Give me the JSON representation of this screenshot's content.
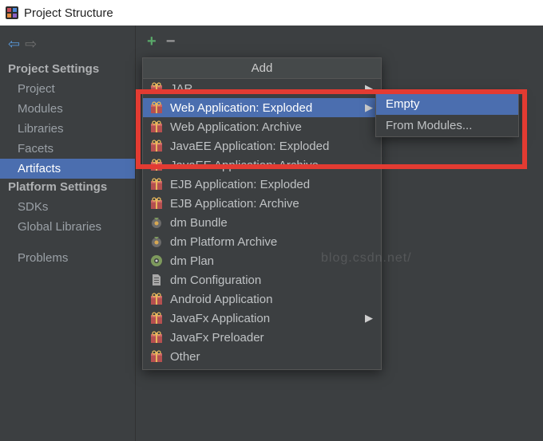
{
  "window": {
    "title": "Project Structure"
  },
  "sidebar": {
    "group1_label": "Project Settings",
    "group1": [
      {
        "label": "Project"
      },
      {
        "label": "Modules"
      },
      {
        "label": "Libraries"
      },
      {
        "label": "Facets"
      },
      {
        "label": "Artifacts",
        "selected": true
      }
    ],
    "group2_label": "Platform Settings",
    "group2": [
      {
        "label": "SDKs"
      },
      {
        "label": "Global Libraries"
      }
    ],
    "group3": [
      {
        "label": "Problems"
      }
    ]
  },
  "popup": {
    "title": "Add",
    "items": [
      {
        "label": "JAR",
        "icon": "gift",
        "submenu": true
      },
      {
        "label": "Web Application: Exploded",
        "icon": "gift",
        "submenu": true,
        "selected": true
      },
      {
        "label": "Web Application: Archive",
        "icon": "gift"
      },
      {
        "label": "JavaEE Application: Exploded",
        "icon": "gift"
      },
      {
        "label": "JavaEE Application: Archive",
        "icon": "gift"
      },
      {
        "label": "EJB Application: Exploded",
        "icon": "gift"
      },
      {
        "label": "EJB Application: Archive",
        "icon": "gift"
      },
      {
        "label": "dm Bundle",
        "icon": "bundle"
      },
      {
        "label": "dm Platform Archive",
        "icon": "bundle"
      },
      {
        "label": "dm Plan",
        "icon": "plan"
      },
      {
        "label": "dm Configuration",
        "icon": "doc"
      },
      {
        "label": "Android Application",
        "icon": "gift"
      },
      {
        "label": "JavaFx Application",
        "icon": "gift",
        "submenu": true
      },
      {
        "label": "JavaFx Preloader",
        "icon": "gift"
      },
      {
        "label": "Other",
        "icon": "gift"
      }
    ]
  },
  "subpopup": {
    "items": [
      {
        "label": "Empty",
        "selected": true
      },
      {
        "label": "From Modules..."
      }
    ]
  },
  "watermark": "blog.csdn.net/"
}
